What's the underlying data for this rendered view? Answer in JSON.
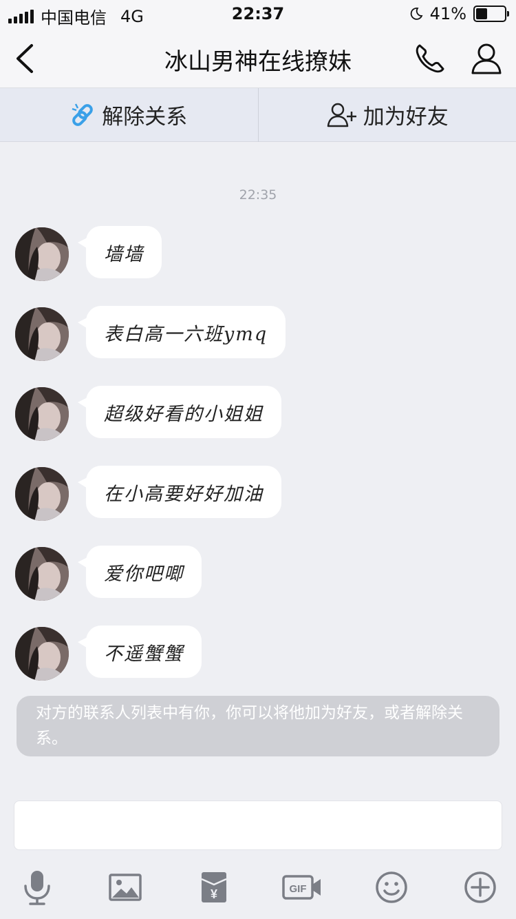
{
  "status_bar": {
    "carrier": "中国电信",
    "network": "4G",
    "time": "22:37",
    "battery": "41%",
    "battery_level": 0.41
  },
  "header": {
    "title": "冰山男神在线撩妹",
    "back_icon": "chevron-left-icon",
    "call_icon": "phone-icon",
    "profile_icon": "person-icon"
  },
  "actions": {
    "unlink_label": "解除关系",
    "unlink_icon": "broken-link-icon",
    "add_friend_label": "加为好友",
    "add_friend_icon": "add-user-icon"
  },
  "chat": {
    "timestamp": "22:35",
    "messages": [
      {
        "text": "墙墙"
      },
      {
        "text": "表白高一六班ymq"
      },
      {
        "text": "超级好看的小姐姐"
      },
      {
        "text": "在小高要好好加油"
      },
      {
        "text": "爱你吧唧"
      },
      {
        "text": "不遥蟹蟹"
      }
    ],
    "system_tip": "对方的联系人列表中有你，你可以将他加为好友，或者解除关系。"
  },
  "input": {
    "placeholder": ""
  },
  "toolbar": {
    "icons": [
      "microphone-icon",
      "image-icon",
      "red-packet-icon",
      "gif-icon",
      "emoji-icon",
      "plus-icon"
    ]
  },
  "colors": {
    "background": "#eeeff3",
    "action_bar": "#e6e9f2",
    "link_accent": "#3aa0e8",
    "icon_gray": "#7b7e86"
  }
}
